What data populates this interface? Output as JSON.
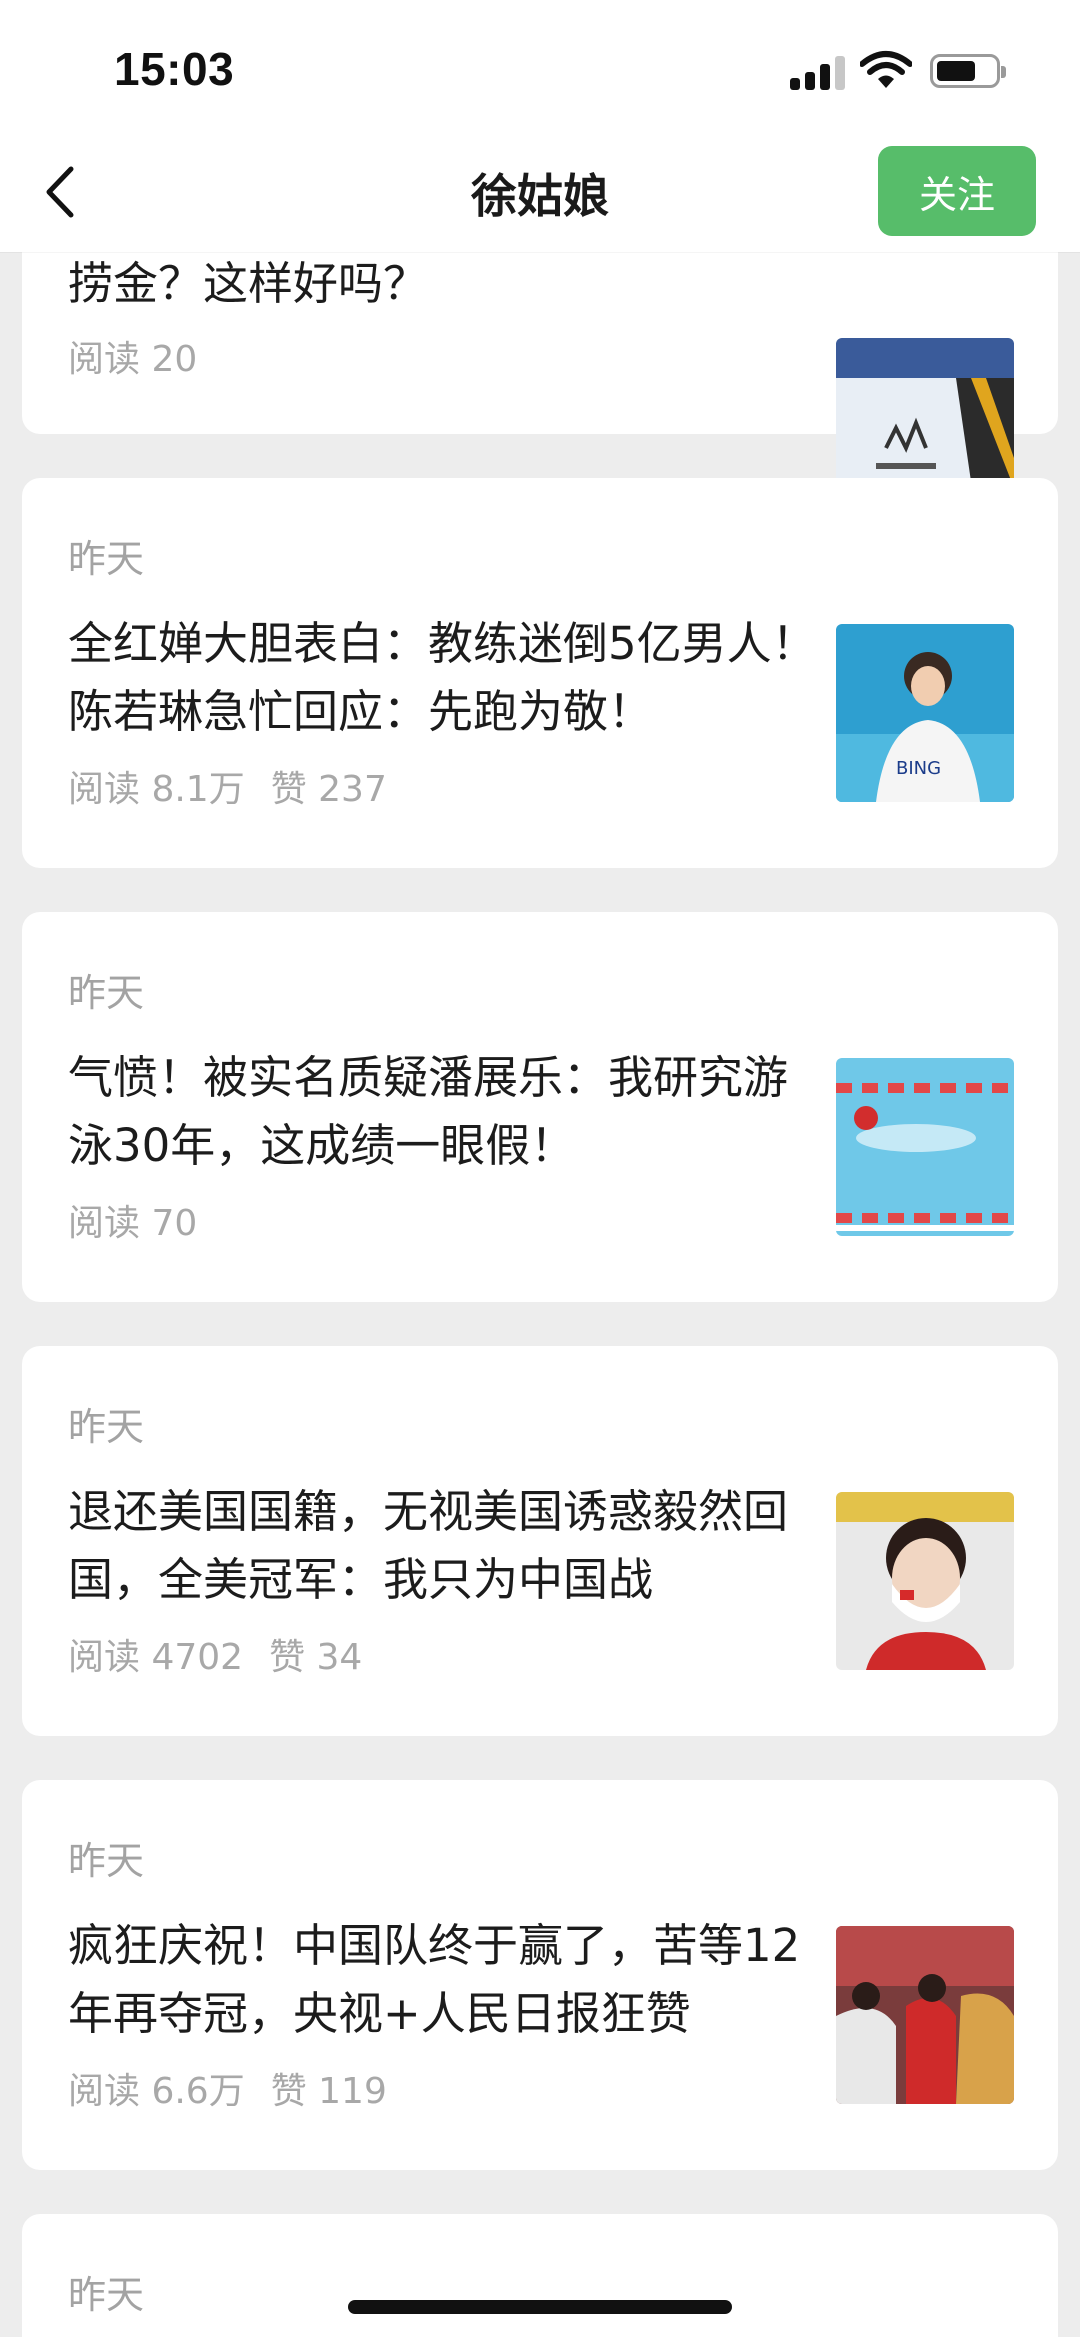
{
  "status_bar": {
    "time": "15:03"
  },
  "header": {
    "title": "徐姑娘",
    "follow_label": "关注"
  },
  "articles": [
    {
      "date": "",
      "title": "捞金？这样好吗？",
      "reads": "阅读 20",
      "likes": ""
    },
    {
      "date": "昨天",
      "title": "全红婵大胆表白：教练迷倒5亿男人！陈若琳急忙回应：先跑为敬！",
      "reads": "阅读 8.1万",
      "likes": "赞 237"
    },
    {
      "date": "昨天",
      "title": "气愤！被实名质疑潘展乐：我研究游泳30年，这成绩一眼假！",
      "reads": "阅读 70",
      "likes": ""
    },
    {
      "date": "昨天",
      "title": "退还美国国籍，无视美国诱惑毅然回国，全美冠军：我只为中国战",
      "reads": "阅读 4702",
      "likes": "赞 34"
    },
    {
      "date": "昨天",
      "title": "疯狂庆祝！中国队终于赢了，苦等12年再夺冠，央视+人民日报狂赞",
      "reads": "阅读 6.6万",
      "likes": "赞 119"
    },
    {
      "date": "昨天",
      "title": "",
      "reads": "",
      "likes": ""
    }
  ],
  "colors": {
    "accent": "#57bd6a",
    "background": "#ededed"
  }
}
